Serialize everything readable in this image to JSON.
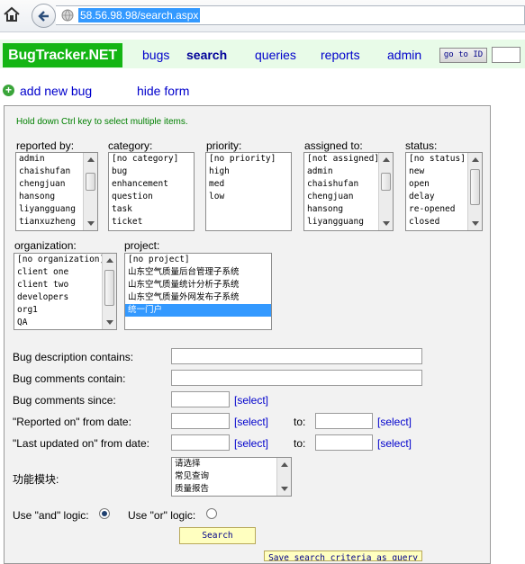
{
  "browser": {
    "url": "58.56.98.98/search.aspx"
  },
  "app": {
    "logo": "BugTracker.NET",
    "nav": [
      "bugs",
      "search",
      "queries",
      "reports",
      "admin"
    ],
    "active_nav": "search",
    "goto_label": "go to ID"
  },
  "actions": {
    "add_bug": "add new bug",
    "hide_form": "hide form"
  },
  "form": {
    "hint": "Hold down Ctrl key to select multiple items.",
    "reported_by": {
      "label": "reported by:",
      "options": [
        "admin",
        "chaishufan",
        "chengjuan",
        "hansong",
        "liyangguang",
        "tianxuzheng"
      ]
    },
    "category": {
      "label": "category:",
      "options": [
        "[no category]",
        "bug",
        "enhancement",
        "question",
        "task",
        "ticket"
      ]
    },
    "priority": {
      "label": "priority:",
      "options": [
        "[no priority]",
        "high",
        "med",
        "low"
      ]
    },
    "assigned_to": {
      "label": "assigned to:",
      "options": [
        "[not assigned]",
        "admin",
        "chaishufan",
        "chengjuan",
        "hansong",
        "liyangguang"
      ]
    },
    "status": {
      "label": "status:",
      "options": [
        "[no status]",
        "new",
        "open",
        "delay",
        "re-opened",
        "closed"
      ]
    },
    "organization": {
      "label": "organization:",
      "options": [
        "[no organization]",
        "client one",
        "client two",
        "developers",
        "org1",
        "QA"
      ]
    },
    "project": {
      "label": "project:",
      "options": [
        "[no project]",
        "山东空气质量后台管理子系统",
        "山东空气质量统计分析子系统",
        "山东空气质量外网发布子系统",
        "统一门户"
      ],
      "selected": "统一门户"
    },
    "desc_contains": "Bug description contains:",
    "comments_contain": "Bug comments contain:",
    "comments_since": "Bug comments since:",
    "reported_from": "\"Reported on\" from date:",
    "updated_from": "\"Last updated on\" from date:",
    "to_label": "to:",
    "select_link": "[select]",
    "module": {
      "label": "功能模块:",
      "options": [
        "请选择",
        "常见查询",
        "质量报告"
      ]
    },
    "and_logic": "Use \"and\" logic:",
    "or_logic": "Use \"or\" logic:",
    "logic_selected": "and",
    "search_btn": "Search",
    "save_btn": "Save search criteria as query"
  }
}
